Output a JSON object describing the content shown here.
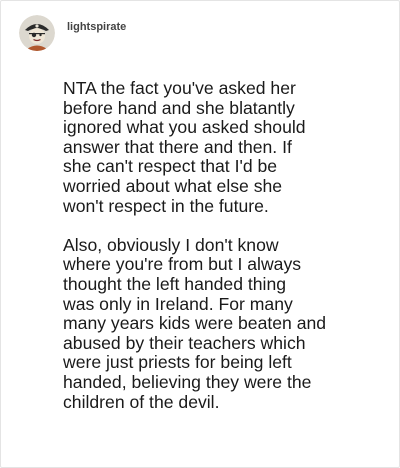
{
  "post": {
    "username": "lightspirate",
    "avatar_icon": "pirate-avatar-icon",
    "paragraphs": [
      "NTA the fact you've asked her\nbefore hand and she blatantly\nignored what you asked should\nanswer that there and then. If\nshe can't respect that I'd be\nworried about what else she\nwon't respect in the future.",
      "Also, obviously I don't know\nwhere you're from but I always\nthought the left handed thing\nwas only in Ireland. For many\nmany years kids were beaten and\nabused by their teachers which\nwere just priests for being left\nhanded, believing they were the\nchildren of the devil."
    ]
  }
}
